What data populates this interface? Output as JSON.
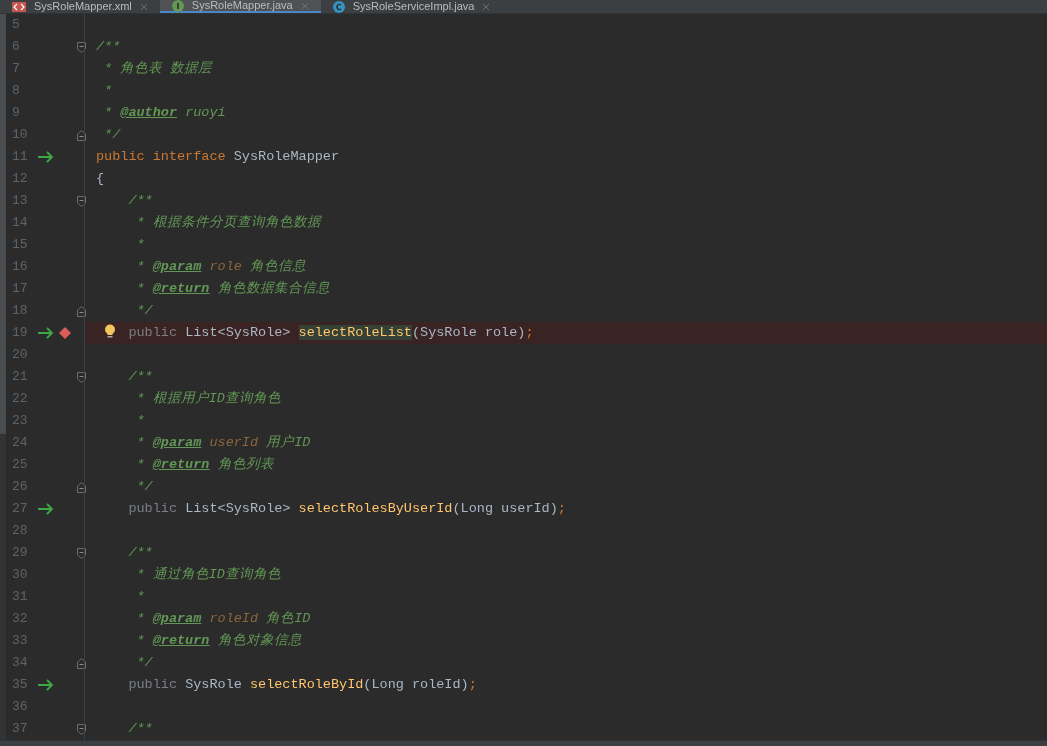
{
  "tabs": [
    {
      "label": "SysRoleMapper.xml",
      "kind": "xml",
      "selected": false
    },
    {
      "label": "SysRoleMapper.java",
      "kind": "interface",
      "selected": true
    },
    {
      "label": "SysRoleServiceImpl.java",
      "kind": "class",
      "selected": false
    }
  ],
  "lines": [
    {
      "number": "5",
      "current": false
    },
    {
      "number": "6",
      "current": false,
      "markers": [
        {
          "kind": "fold-start"
        }
      ],
      "tokens": [
        {
          "kind": "comment",
          "text": "/**"
        }
      ]
    },
    {
      "number": "7",
      "current": false,
      "tokens": [
        {
          "kind": "comment",
          "text": " * 角色表 数据层"
        }
      ]
    },
    {
      "number": "8",
      "current": false,
      "tokens": [
        {
          "kind": "comment",
          "text": " *"
        }
      ]
    },
    {
      "number": "9",
      "current": false,
      "tokens": [
        {
          "kind": "comment",
          "text": " * "
        },
        {
          "kind": "tag",
          "text": "@author"
        },
        {
          "kind": "comment",
          "text": " ruoyi"
        }
      ]
    },
    {
      "number": "10",
      "current": false,
      "markers": [
        {
          "kind": "fold-end"
        }
      ],
      "tokens": [
        {
          "kind": "comment",
          "text": " */"
        }
      ]
    },
    {
      "number": "11",
      "current": false,
      "markers": [
        {
          "kind": "arrow"
        }
      ],
      "tokens": [
        {
          "kind": "keyword",
          "text": "public interface "
        },
        {
          "kind": "plain",
          "text": "SysRoleMapper"
        }
      ]
    },
    {
      "number": "12",
      "current": false,
      "tokens": [
        {
          "kind": "plain",
          "text": "{"
        }
      ]
    },
    {
      "number": "13",
      "current": false,
      "markers": [
        {
          "kind": "fold-start"
        }
      ],
      "tokens": [
        {
          "kind": "comment",
          "text": "    /**"
        }
      ]
    },
    {
      "number": "14",
      "current": false,
      "tokens": [
        {
          "kind": "comment",
          "text": "     * 根据条件分页查询角色数据"
        }
      ]
    },
    {
      "number": "15",
      "current": false,
      "tokens": [
        {
          "kind": "comment",
          "text": "     *"
        }
      ]
    },
    {
      "number": "16",
      "current": false,
      "tokens": [
        {
          "kind": "comment",
          "text": "     * "
        },
        {
          "kind": "tag",
          "text": "@param"
        },
        {
          "kind": "param",
          "text": " role"
        },
        {
          "kind": "comment",
          "text": " 角色信息"
        }
      ]
    },
    {
      "number": "17",
      "current": false,
      "tokens": [
        {
          "kind": "comment",
          "text": "     * "
        },
        {
          "kind": "tag",
          "text": "@return"
        },
        {
          "kind": "comment",
          "text": " 角色数据集合信息"
        }
      ]
    },
    {
      "number": "18",
      "current": false,
      "markers": [
        {
          "kind": "fold-end"
        }
      ],
      "tokens": [
        {
          "kind": "comment",
          "text": "     */"
        }
      ]
    },
    {
      "number": "19",
      "current": true,
      "markers": [
        {
          "kind": "arrow"
        },
        {
          "kind": "breakpoint"
        },
        {
          "kind": "bulb"
        }
      ],
      "tokens": [
        {
          "kind": "unused",
          "text": "    public "
        },
        {
          "kind": "plain",
          "text": "List<SysRole> "
        },
        {
          "kind": "method-highlight",
          "text": "selectRoleList"
        },
        {
          "kind": "plain",
          "text": "(SysRole role)"
        },
        {
          "kind": "keyword",
          "text": ";"
        }
      ]
    },
    {
      "number": "20",
      "current": false
    },
    {
      "number": "21",
      "current": false,
      "markers": [
        {
          "kind": "fold-start"
        }
      ],
      "tokens": [
        {
          "kind": "comment",
          "text": "    /**"
        }
      ]
    },
    {
      "number": "22",
      "current": false,
      "tokens": [
        {
          "kind": "comment",
          "text": "     * 根据用户ID查询角色"
        }
      ]
    },
    {
      "number": "23",
      "current": false,
      "tokens": [
        {
          "kind": "comment",
          "text": "     *"
        }
      ]
    },
    {
      "number": "24",
      "current": false,
      "tokens": [
        {
          "kind": "comment",
          "text": "     * "
        },
        {
          "kind": "tag",
          "text": "@param"
        },
        {
          "kind": "param",
          "text": " userId"
        },
        {
          "kind": "comment",
          "text": " 用户ID"
        }
      ]
    },
    {
      "number": "25",
      "current": false,
      "tokens": [
        {
          "kind": "comment",
          "text": "     * "
        },
        {
          "kind": "tag",
          "text": "@return"
        },
        {
          "kind": "comment",
          "text": " 角色列表"
        }
      ]
    },
    {
      "number": "26",
      "current": false,
      "markers": [
        {
          "kind": "fold-end"
        }
      ],
      "tokens": [
        {
          "kind": "comment",
          "text": "     */"
        }
      ]
    },
    {
      "number": "27",
      "current": false,
      "markers": [
        {
          "kind": "arrow"
        }
      ],
      "tokens": [
        {
          "kind": "unused",
          "text": "    public "
        },
        {
          "kind": "plain",
          "text": "List<SysRole> "
        },
        {
          "kind": "method",
          "text": "selectRolesByUserId"
        },
        {
          "kind": "plain",
          "text": "(Long userId)"
        },
        {
          "kind": "keyword",
          "text": ";"
        }
      ]
    },
    {
      "number": "28",
      "current": false
    },
    {
      "number": "29",
      "current": false,
      "markers": [
        {
          "kind": "fold-start"
        }
      ],
      "tokens": [
        {
          "kind": "comment",
          "text": "    /**"
        }
      ]
    },
    {
      "number": "30",
      "current": false,
      "tokens": [
        {
          "kind": "comment",
          "text": "     * 通过角色ID查询角色"
        }
      ]
    },
    {
      "number": "31",
      "current": false,
      "tokens": [
        {
          "kind": "comment",
          "text": "     *"
        }
      ]
    },
    {
      "number": "32",
      "current": false,
      "tokens": [
        {
          "kind": "comment",
          "text": "     * "
        },
        {
          "kind": "tag",
          "text": "@param"
        },
        {
          "kind": "param",
          "text": " roleId"
        },
        {
          "kind": "comment",
          "text": " 角色ID"
        }
      ]
    },
    {
      "number": "33",
      "current": false,
      "tokens": [
        {
          "kind": "comment",
          "text": "     * "
        },
        {
          "kind": "tag",
          "text": "@return"
        },
        {
          "kind": "comment",
          "text": " 角色对象信息"
        }
      ]
    },
    {
      "number": "34",
      "current": false,
      "markers": [
        {
          "kind": "fold-end"
        }
      ],
      "tokens": [
        {
          "kind": "comment",
          "text": "     */"
        }
      ]
    },
    {
      "number": "35",
      "current": false,
      "markers": [
        {
          "kind": "arrow"
        }
      ],
      "tokens": [
        {
          "kind": "unused",
          "text": "    public "
        },
        {
          "kind": "plain",
          "text": "SysRole "
        },
        {
          "kind": "method",
          "text": "selectRoleById"
        },
        {
          "kind": "plain",
          "text": "(Long roleId)"
        },
        {
          "kind": "keyword",
          "text": ";"
        }
      ]
    },
    {
      "number": "36",
      "current": false
    },
    {
      "number": "37",
      "current": false,
      "markers": [
        {
          "kind": "fold-start"
        }
      ],
      "tokens": [
        {
          "kind": "comment",
          "text": "    /**"
        }
      ]
    }
  ]
}
